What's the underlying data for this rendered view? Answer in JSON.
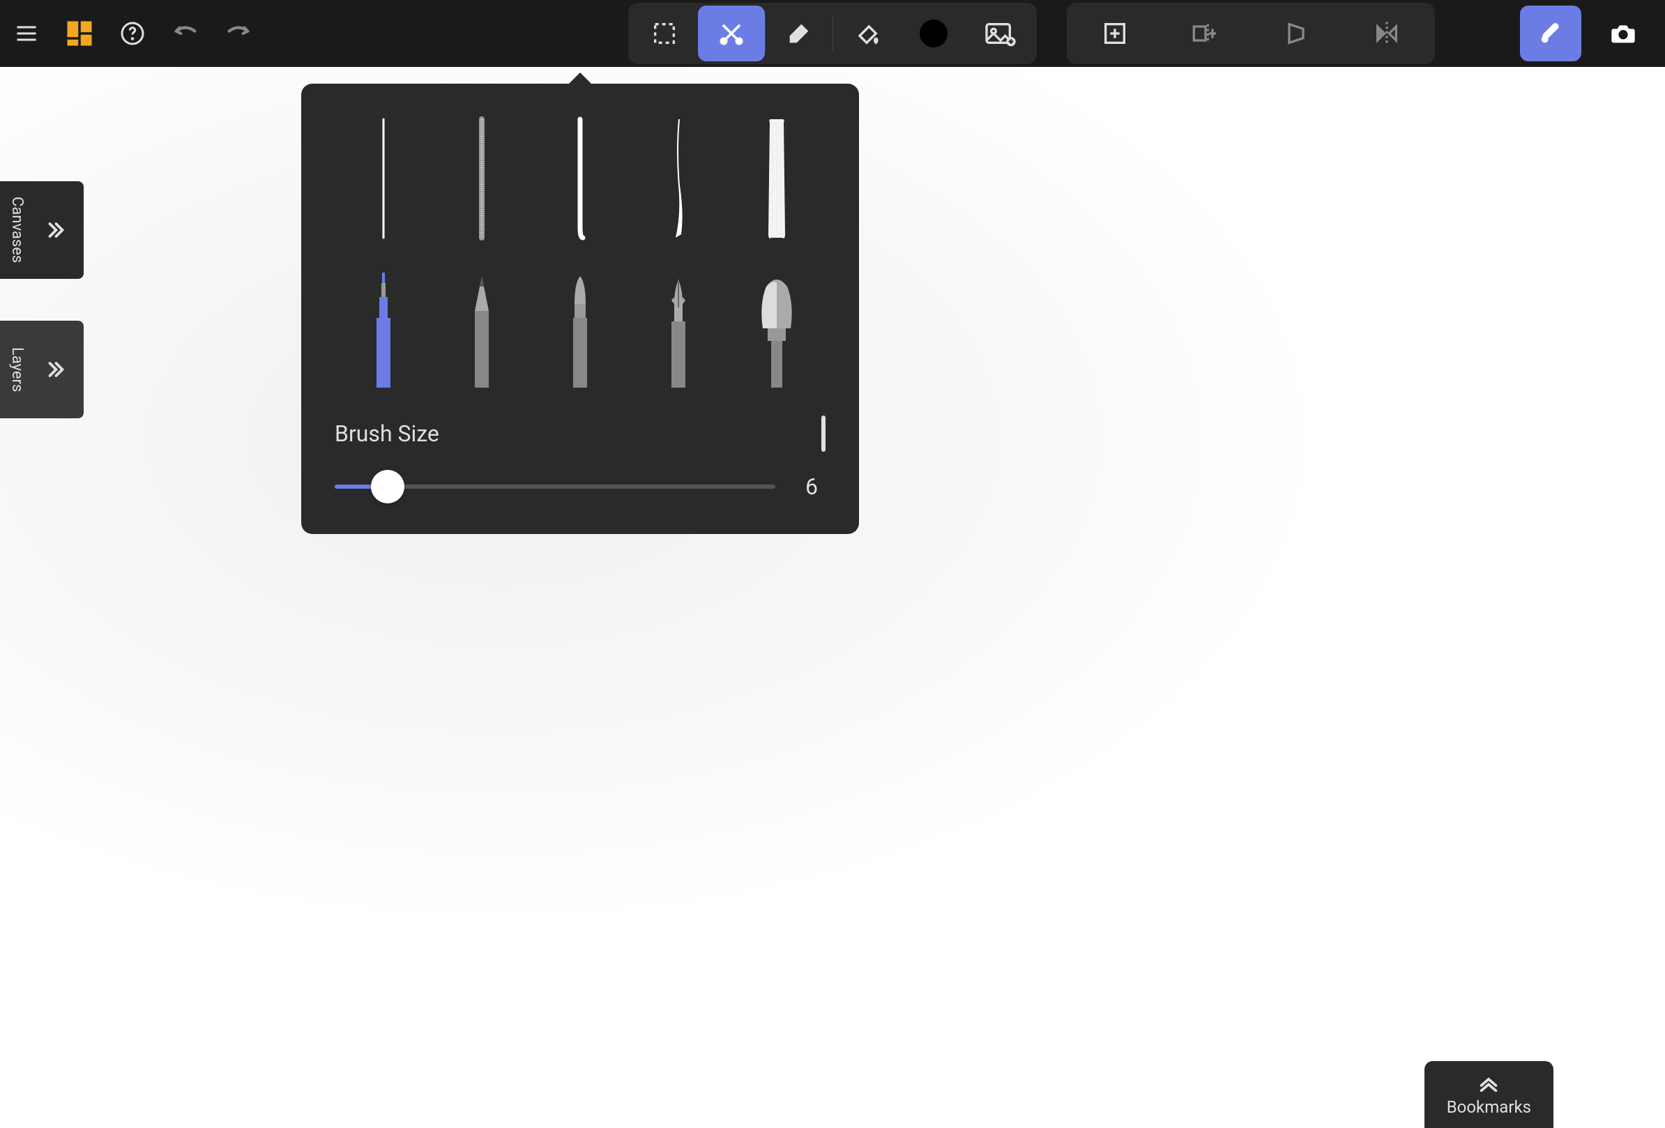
{
  "colors": {
    "accent": "#6b7de5",
    "toolbar_bg": "#1a1a1a",
    "panel_bg": "#2a2a2a",
    "current_color": "#000000"
  },
  "side_panels": {
    "canvases_label": "Canvases",
    "layers_label": "Layers"
  },
  "brush_popup": {
    "size_label": "Brush Size",
    "size_value": "6",
    "brushes": [
      {
        "id": "fineliner",
        "selected": true
      },
      {
        "id": "pencil",
        "selected": false
      },
      {
        "id": "marker",
        "selected": false
      },
      {
        "id": "calligraphy",
        "selected": false
      },
      {
        "id": "paint-brush",
        "selected": false
      }
    ]
  },
  "bookmarks": {
    "label": "Bookmarks"
  }
}
